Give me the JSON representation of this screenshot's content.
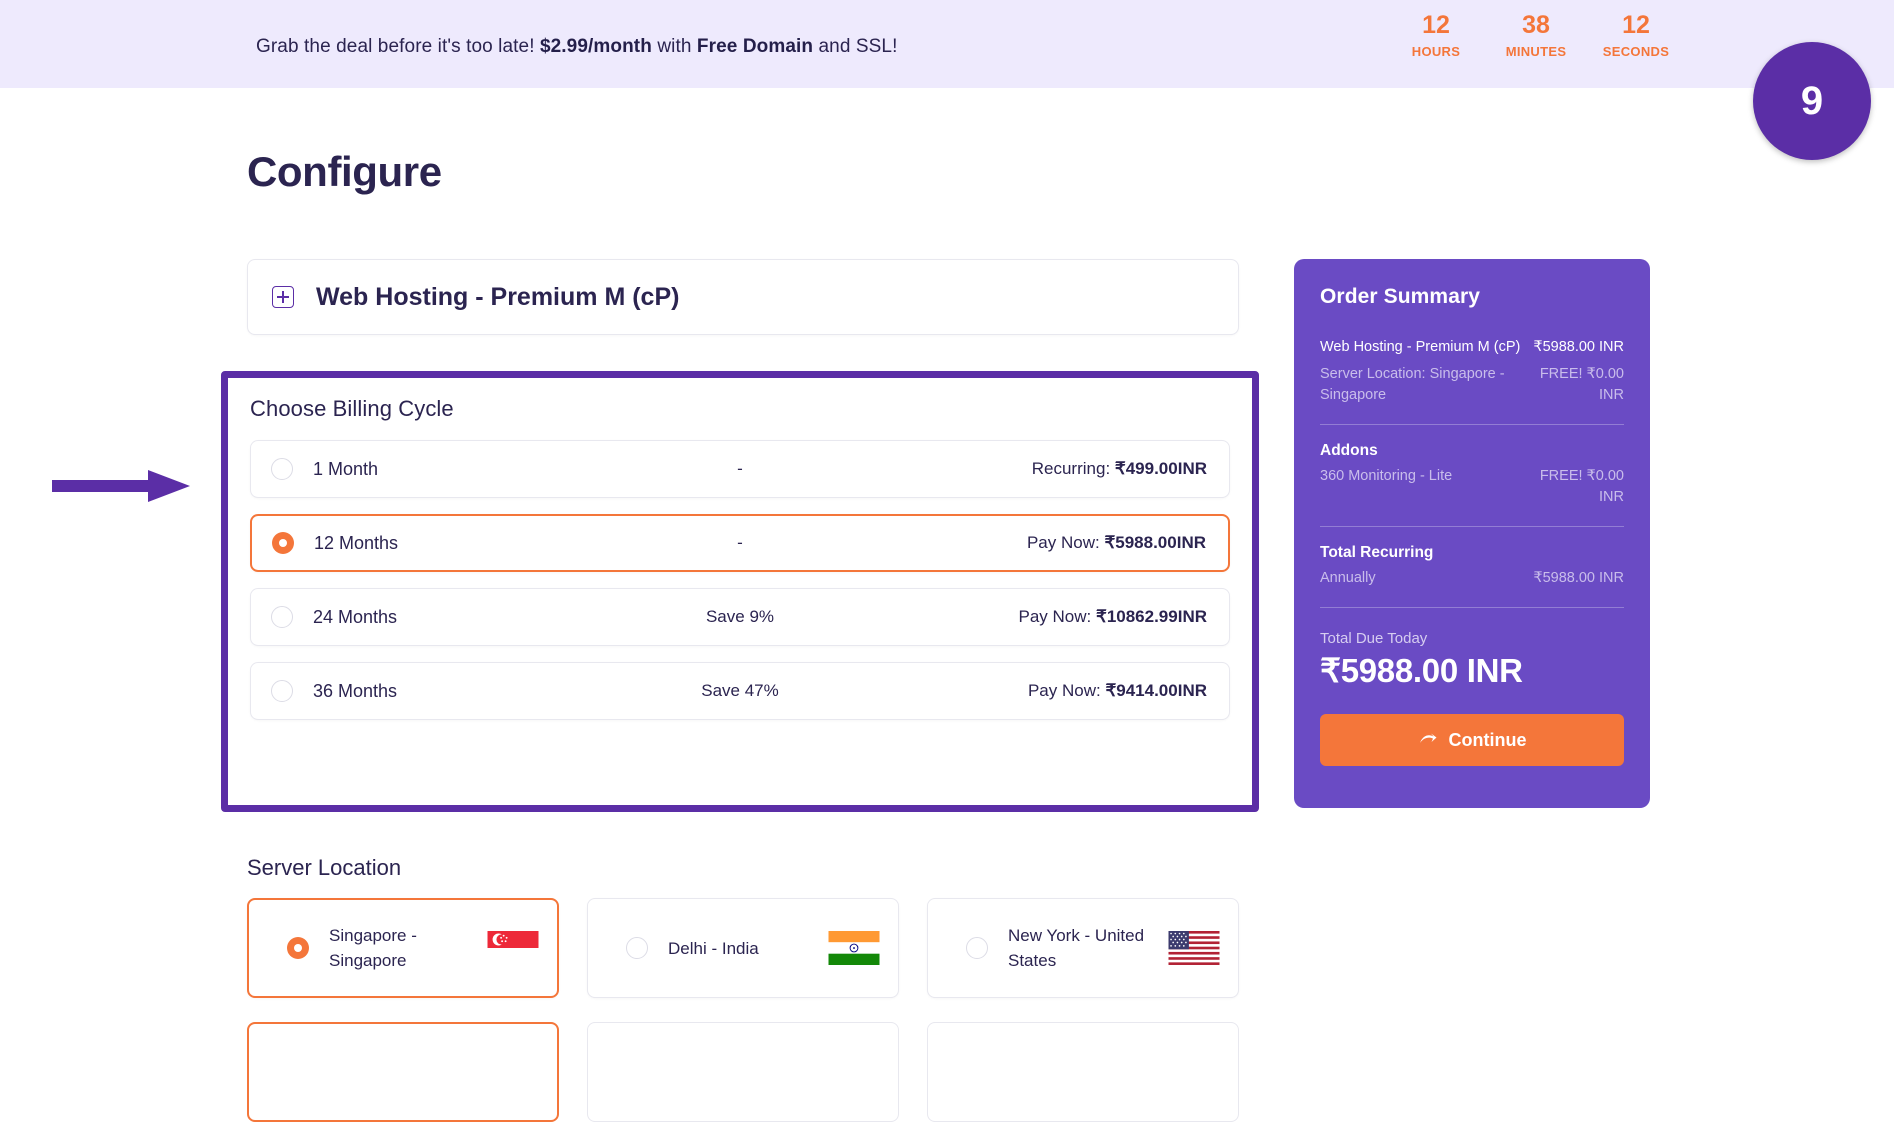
{
  "promo": {
    "text_before": "Grab the deal before it's too late!",
    "price": "$2.99/month",
    "text_mid": "with",
    "feature": "Free Domain",
    "text_after": "and SSL!",
    "countdown": [
      {
        "value": "12",
        "label": "HOURS"
      },
      {
        "value": "38",
        "label": "MINUTES"
      },
      {
        "value": "12",
        "label": "SECONDS"
      }
    ],
    "badge": "9"
  },
  "page": {
    "title": "Configure"
  },
  "product": {
    "expand_icon": "plus-square-icon",
    "name": "Web Hosting - Premium M (cP)"
  },
  "billing": {
    "heading": "Choose Billing Cycle",
    "options": [
      {
        "term": "1 Month",
        "save": "-",
        "price_label": "Recurring:",
        "price": "₹499.00INR",
        "selected": false
      },
      {
        "term": "12 Months",
        "save": "-",
        "price_label": "Pay Now:",
        "price": "₹5988.00INR",
        "selected": true
      },
      {
        "term": "24 Months",
        "save": "Save 9%",
        "price_label": "Pay Now:",
        "price": "₹10862.99INR",
        "selected": false
      },
      {
        "term": "36 Months",
        "save": "Save 47%",
        "price_label": "Pay Now:",
        "price": "₹9414.00INR",
        "selected": false
      }
    ]
  },
  "server_location": {
    "heading": "Server Location",
    "options": [
      {
        "label": "Singapore - Singapore",
        "flag": "flag-singapore-icon",
        "selected": true
      },
      {
        "label": "Delhi - India",
        "flag": "flag-india-icon",
        "selected": false
      },
      {
        "label": "New York - United States",
        "flag": "flag-usa-icon",
        "selected": false
      }
    ]
  },
  "order_summary": {
    "title": "Order Summary",
    "items": [
      {
        "name": "Web Hosting - Premium M (cP)",
        "value": "₹5988.00 INR",
        "muted": false
      },
      {
        "name": "Server Location: Singapore - Singapore",
        "value": "FREE! ₹0.00 INR",
        "muted": true
      }
    ],
    "addons_title": "Addons",
    "addons": [
      {
        "name": "360 Monitoring - Lite",
        "value": "FREE! ₹0.00 INR"
      }
    ],
    "recurring_title": "Total Recurring",
    "recurring": {
      "name": "Annually",
      "value": "₹5988.00 INR"
    },
    "total_label": "Total Due Today",
    "total_value": "₹5988.00 INR",
    "continue_label": "Continue",
    "continue_icon": "arrow-right-icon"
  },
  "annotation": {
    "arrow_icon": "annotation-arrow-right-icon",
    "color": "#5b2ea6"
  },
  "colors": {
    "banner_bg": "#eeeafd",
    "accent_orange": "#f4763a",
    "brand_purple": "#5b2ea6",
    "summary_purple": "#6a4bc4",
    "text_dark": "#2b2450"
  }
}
